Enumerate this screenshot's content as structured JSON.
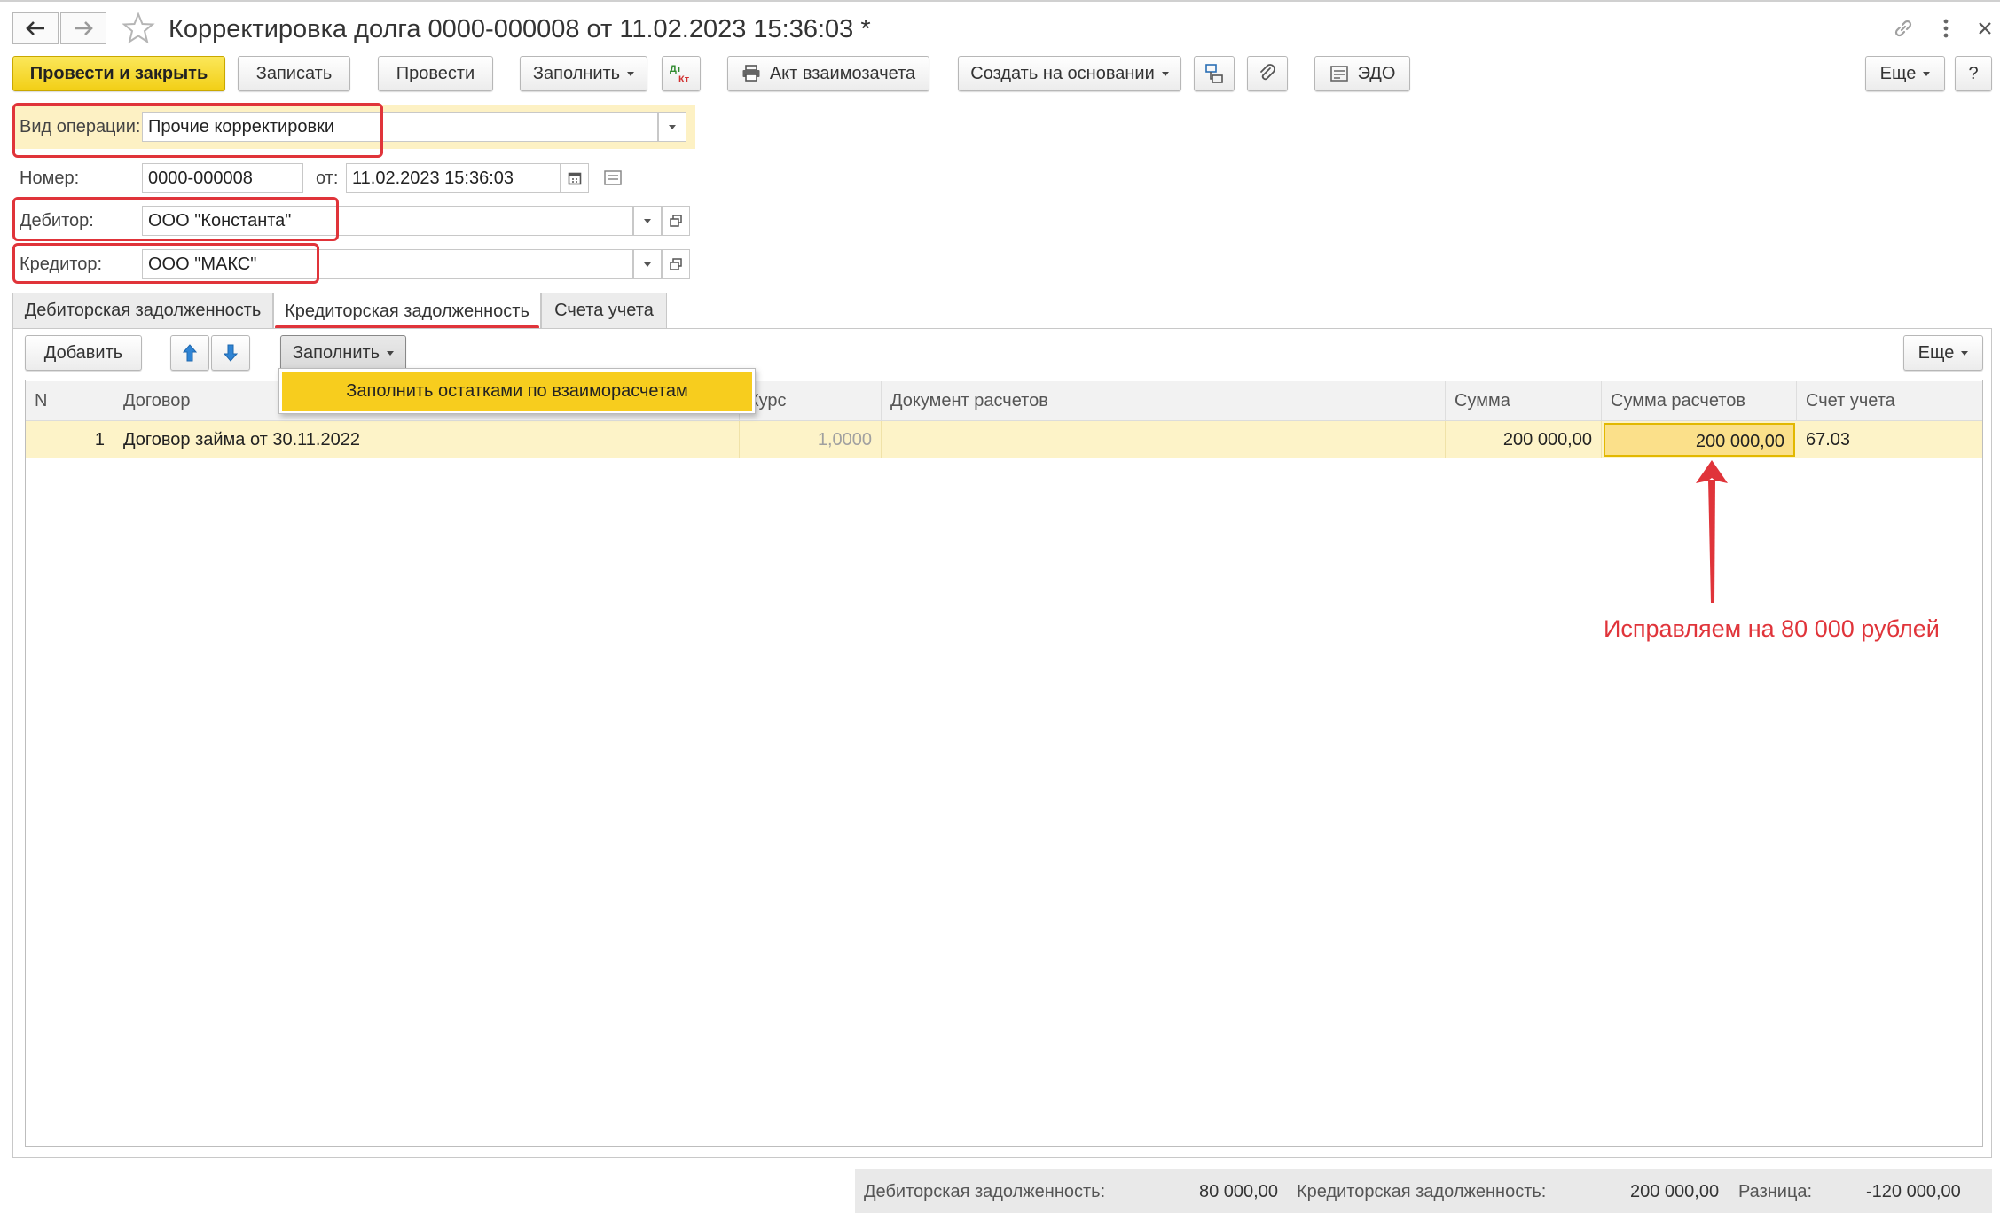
{
  "window": {
    "title": "Корректировка долга 0000-000008 от 11.02.2023 15:36:03 *"
  },
  "toolbar": {
    "post_close": "Провести и закрыть",
    "save": "Записать",
    "post": "Провести",
    "fill": "Заполнить",
    "dt_kt": "Дт Кт",
    "act": "Акт взаимозачета",
    "create_based": "Создать на основании",
    "edo": "ЭДО",
    "more": "Еще",
    "help": "?"
  },
  "form": {
    "operation_label": "Вид операции:",
    "operation_value": "Прочие корректировки",
    "number_label": "Номер:",
    "number_value": "0000-000008",
    "date_label": "от:",
    "date_value": "11.02.2023 15:36:03",
    "debtor_label": "Дебитор:",
    "debtor_value": "ООО \"Константа\"",
    "creditor_label": "Кредитор:",
    "creditor_value": "ООО \"МАКС\""
  },
  "tabs": [
    {
      "label": "Дебиторская задолженность"
    },
    {
      "label": "Кредиторская задолженность"
    },
    {
      "label": "Счета учета"
    }
  ],
  "table_toolbar": {
    "add": "Добавить",
    "fill": "Заполнить",
    "more": "Еще",
    "menu_item": "Заполнить остатками по взаиморасчетам"
  },
  "table": {
    "columns": [
      "N",
      "Договор",
      "Курс",
      "Документ расчетов",
      "Сумма",
      "Сумма расчетов",
      "Счет учета"
    ],
    "rows": [
      {
        "n": "1",
        "contract": "Договор займа от 30.11.2022",
        "rate": "1,0000",
        "document": "",
        "sum": "200 000,00",
        "settlement_sum": "200 000,00",
        "account": "67.03"
      }
    ]
  },
  "annotation": {
    "text": "Исправляем на 80 000 рублей",
    "color": "#e0343a"
  },
  "footer": {
    "debit_label": "Дебиторская задолженность:",
    "debit_value": "80 000,00",
    "credit_label": "Кредиторская задолженность:",
    "credit_value": "200 000,00",
    "diff_label": "Разница:",
    "diff_value": "-120 000,00"
  },
  "colors": {
    "accent_yellow": "#f5d41c",
    "row_highlight": "#fdf3c8",
    "annotation_red": "#e0343a"
  }
}
